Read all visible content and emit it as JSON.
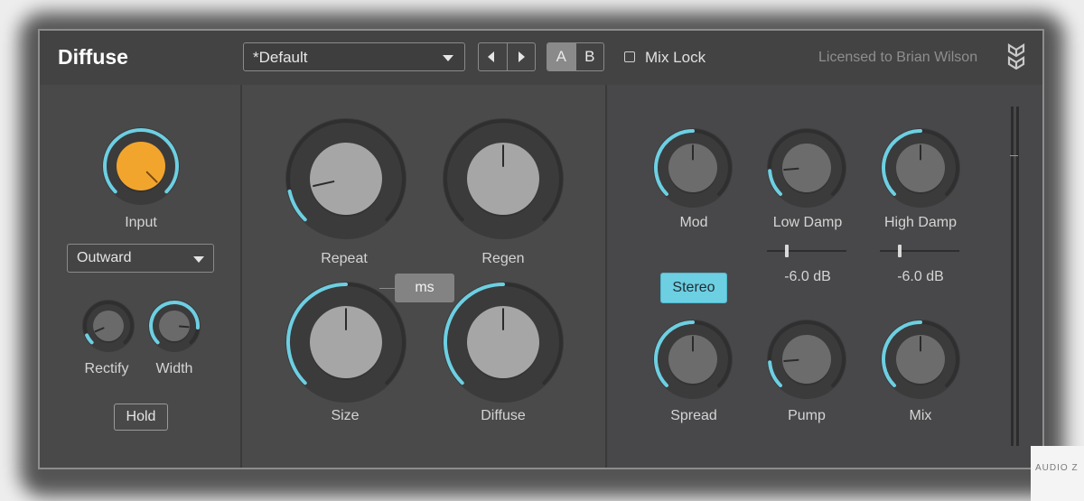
{
  "header": {
    "title": "Diffuse",
    "preset": "*Default",
    "ab": {
      "a": "A",
      "b": "B"
    },
    "mix_lock_label": "Mix Lock",
    "mix_lock_checked": false,
    "license": "Licensed to Brian Wilson"
  },
  "left_panel": {
    "input_label": "Input",
    "direction_select": "Outward",
    "rectify_label": "Rectify",
    "width_label": "Width",
    "hold_label": "Hold"
  },
  "center_panel": {
    "repeat_label": "Repeat",
    "ms_label": "ms",
    "regen_label": "Regen",
    "size_label": "Size",
    "diffuse_label": "Diffuse"
  },
  "right_panel": {
    "mod_label": "Mod",
    "stereo_label": "Stereo",
    "low_damp_label": "Low Damp",
    "low_damp_value": "-6.0 dB",
    "low_damp_level": 0.25,
    "high_damp_label": "High Damp",
    "high_damp_value": "-6.0 dB",
    "high_damp_level": 0.25,
    "spread_label": "Spread",
    "pump_label": "Pump",
    "mix_label": "Mix"
  },
  "watermark": "AUDIO Z",
  "colors": {
    "accent": "#6dcfe2",
    "input_knob": "#f2a52d",
    "panel": "#4a4a4b",
    "header": "#434344"
  },
  "icons": {
    "logo": "diffuse-logo-icon",
    "preset_dropdown": "caret-down-icon",
    "prev": "triangle-left-icon",
    "next": "triangle-right-icon"
  }
}
